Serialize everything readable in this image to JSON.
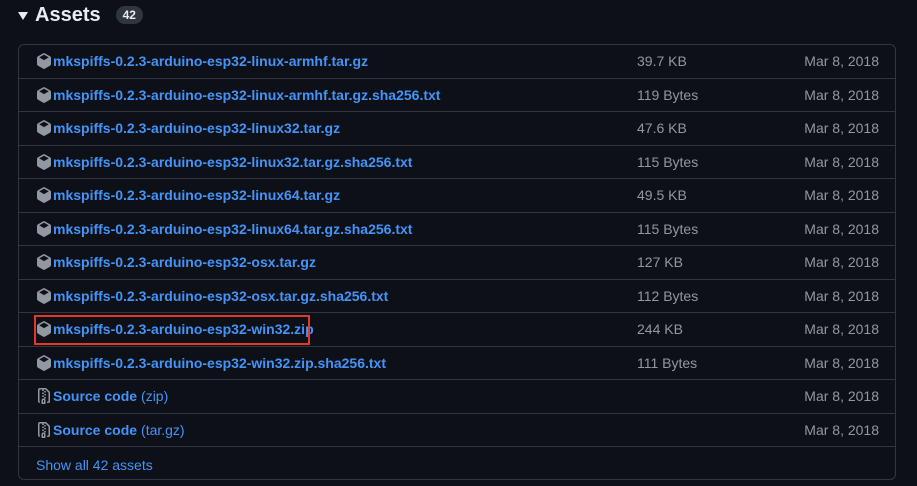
{
  "header": {
    "title": "Assets",
    "count": "42"
  },
  "assets": [
    {
      "name": "mkspiffs-0.2.3-arduino-esp32-linux-armhf.tar.gz",
      "size": "39.7 KB",
      "date": "Mar 8, 2018"
    },
    {
      "name": "mkspiffs-0.2.3-arduino-esp32-linux-armhf.tar.gz.sha256.txt",
      "size": "119 Bytes",
      "date": "Mar 8, 2018"
    },
    {
      "name": "mkspiffs-0.2.3-arduino-esp32-linux32.tar.gz",
      "size": "47.6 KB",
      "date": "Mar 8, 2018"
    },
    {
      "name": "mkspiffs-0.2.3-arduino-esp32-linux32.tar.gz.sha256.txt",
      "size": "115 Bytes",
      "date": "Mar 8, 2018"
    },
    {
      "name": "mkspiffs-0.2.3-arduino-esp32-linux64.tar.gz",
      "size": "49.5 KB",
      "date": "Mar 8, 2018"
    },
    {
      "name": "mkspiffs-0.2.3-arduino-esp32-linux64.tar.gz.sha256.txt",
      "size": "115 Bytes",
      "date": "Mar 8, 2018"
    },
    {
      "name": "mkspiffs-0.2.3-arduino-esp32-osx.tar.gz",
      "size": "127 KB",
      "date": "Mar 8, 2018"
    },
    {
      "name": "mkspiffs-0.2.3-arduino-esp32-osx.tar.gz.sha256.txt",
      "size": "112 Bytes",
      "date": "Mar 8, 2018"
    },
    {
      "name": "mkspiffs-0.2.3-arduino-esp32-win32.zip",
      "size": "244 KB",
      "date": "Mar 8, 2018"
    },
    {
      "name": "mkspiffs-0.2.3-arduino-esp32-win32.zip.sha256.txt",
      "size": "111 Bytes",
      "date": "Mar 8, 2018"
    }
  ],
  "source_code": [
    {
      "label": "Source code",
      "format": "(zip)",
      "date": "Mar 8, 2018"
    },
    {
      "label": "Source code",
      "format": "(tar.gz)",
      "date": "Mar 8, 2018"
    }
  ],
  "show_all": "Show all 42 assets",
  "colors": {
    "link": "#4493f8",
    "muted": "#9198a1",
    "border": "#30363d",
    "highlight": "#e5362c",
    "background": "#0d1117"
  },
  "icons": {
    "asset": "package-icon",
    "source": "file-zip-icon",
    "toggle": "caret-down-icon"
  }
}
